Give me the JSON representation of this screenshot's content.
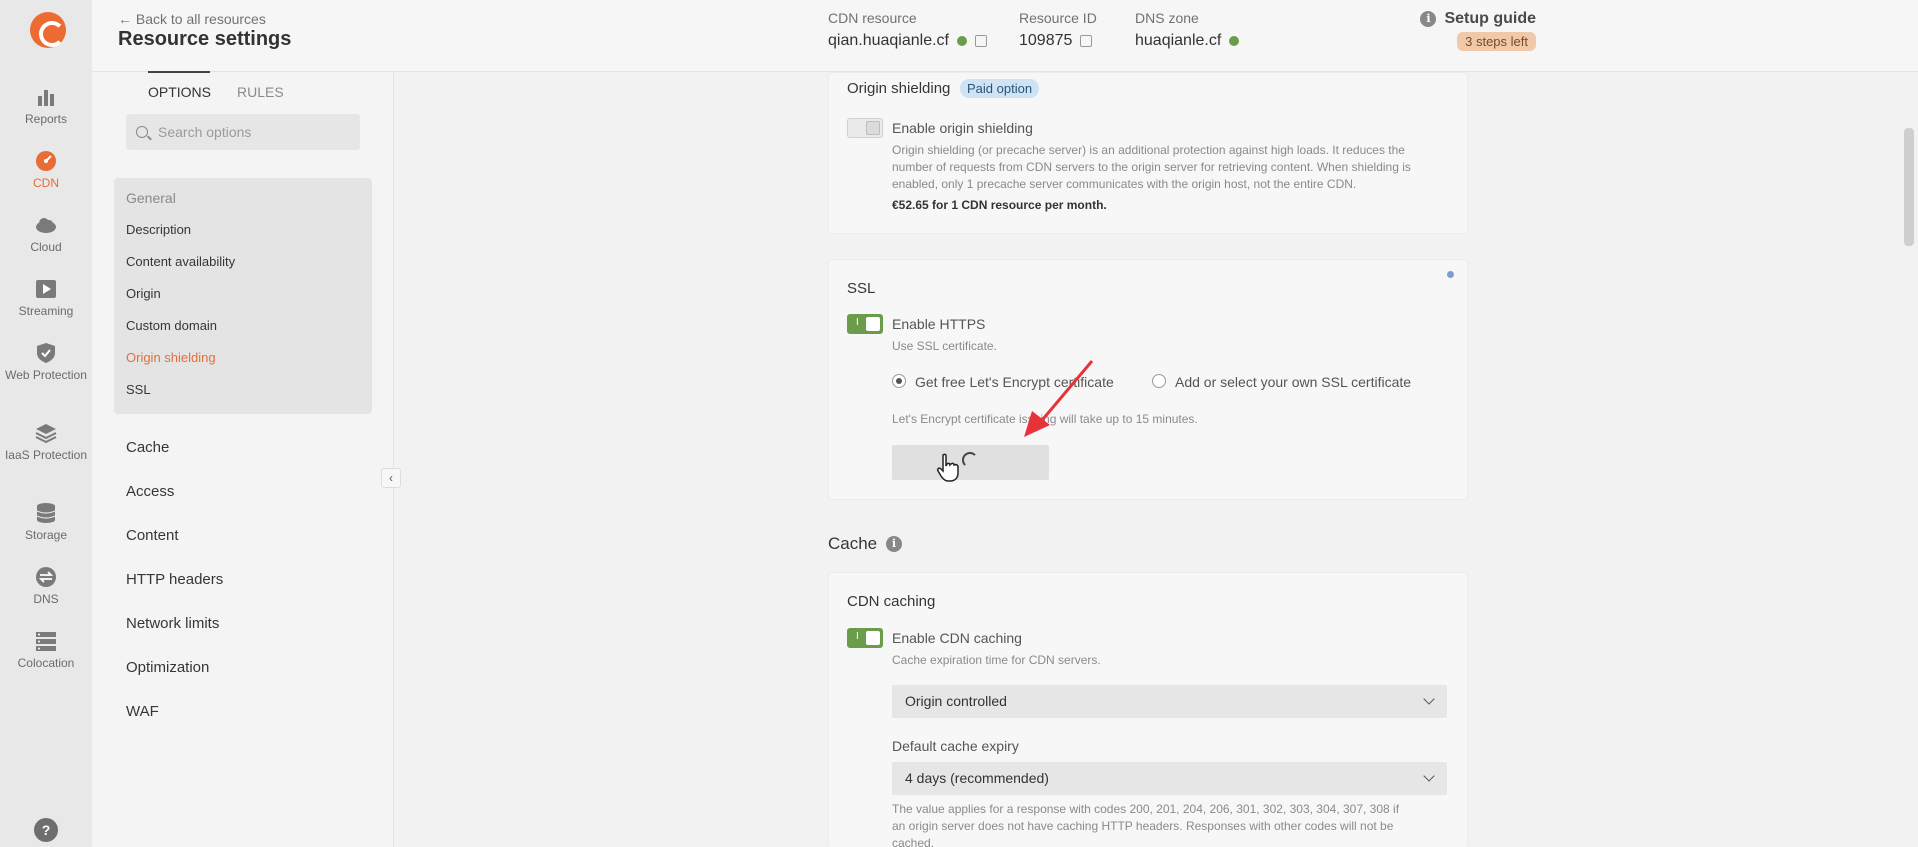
{
  "rail": {
    "items": [
      {
        "label": "Reports",
        "icon": "bar-chart-icon"
      },
      {
        "label": "CDN",
        "icon": "speedometer-icon"
      },
      {
        "label": "Cloud",
        "icon": "cloud-icon"
      },
      {
        "label": "Streaming",
        "icon": "play-icon"
      },
      {
        "label": "Web Protection",
        "icon": "shield-icon"
      },
      {
        "label": "IaaS Protection",
        "icon": "layers-icon"
      },
      {
        "label": "Storage",
        "icon": "database-icon"
      },
      {
        "label": "DNS",
        "icon": "dns-icon"
      },
      {
        "label": "Colocation",
        "icon": "server-rack-icon"
      }
    ],
    "help": "?"
  },
  "header": {
    "back": "← Back to all resources",
    "title": "Resource settings",
    "cdn_label": "CDN resource",
    "cdn_value": "qian.huaqianle.cf",
    "rid_label": "Resource ID",
    "rid_value": "109875",
    "dns_label": "DNS zone",
    "dns_value": "huaqianle.cf",
    "guide": "Setup guide",
    "steps": "3 steps left"
  },
  "options": {
    "tab_options": "OPTIONS",
    "tab_rules": "RULES",
    "search_placeholder": "Search options",
    "general": "General",
    "general_items": [
      "Description",
      "Content availability",
      "Origin",
      "Custom domain",
      "Origin shielding",
      "SSL"
    ],
    "sections": [
      "Cache",
      "Access",
      "Content",
      "HTTP headers",
      "Network limits",
      "Optimization",
      "WAF"
    ]
  },
  "shield": {
    "title": "Origin shielding",
    "paid": "Paid option",
    "toggle": "Enable origin shielding",
    "desc1": "Origin shielding (or precache server) is an additional protection against high loads. It reduces the",
    "desc2": "number of requests from CDN servers to the origin server for retrieving content. When shielding is",
    "desc3": "enabled, only 1 precache server communicates with the origin host, not the entire CDN.",
    "price": "€52.65 for 1 CDN resource per month."
  },
  "ssl": {
    "title": "SSL",
    "toggle": "Enable HTTPS",
    "hint": "Use SSL certificate.",
    "radio1": "Get free Let's Encrypt certificate",
    "radio2": "Add or select your own SSL certificate",
    "note": "Let's Encrypt certificate issuing will take up to 15 minutes."
  },
  "cache": {
    "heading": "Cache",
    "card_title": "CDN caching",
    "toggle": "Enable CDN caching",
    "hint": "Cache expiration time for CDN servers.",
    "mode": "Origin controlled",
    "expiry_label": "Default cache expiry",
    "expiry_value": "4 days (recommended)",
    "note1": "The value applies for a response with codes 200, 201, 204, 206, 301, 302, 303, 304, 307, 308 if",
    "note2": "an origin server does not have caching HTTP headers. Responses with other codes will not be",
    "note3": "cached."
  },
  "colors": {
    "accent": "#e86c35",
    "toggle_on": "#6b9c4b",
    "arrow": "#e8323a"
  }
}
